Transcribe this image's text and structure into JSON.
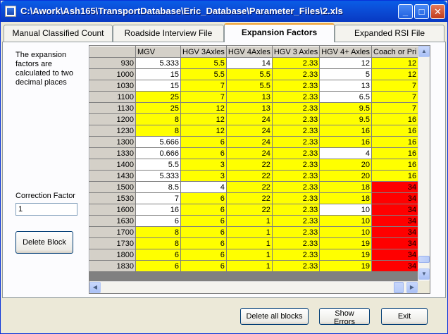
{
  "window": {
    "title": "C:\\Awork\\Ash165\\TransportDatabase\\Eric_Database\\Parameter_Files\\2.xls"
  },
  "tabs": [
    {
      "label": "Manual Classified Count",
      "active": false
    },
    {
      "label": "Roadside Interview File",
      "active": false
    },
    {
      "label": "Expansion Factors",
      "active": true
    },
    {
      "label": "Expanded RSI File",
      "active": false
    }
  ],
  "info_text": "The expansion factors are calculated to two decimal places",
  "correction_factor": {
    "label": "Correction Factor",
    "value": "1"
  },
  "buttons": {
    "delete_block": "Delete Block",
    "delete_all_blocks": "Delete all blocks",
    "show_errors": "Show Errors",
    "exit": "Exit"
  },
  "colors": {
    "yellow": "#ffff00",
    "red": "#ff0000",
    "white": "#ffffff"
  },
  "grid": {
    "columns": [
      "MGV",
      "HGV 3Axles",
      "HGV 4Axles",
      "HGV 3 Axles",
      "HGV 4+ Axles",
      "Coach or Pri"
    ],
    "rows": [
      {
        "time": "930",
        "cells": [
          [
            "5.333",
            "w"
          ],
          [
            "5.5",
            "y"
          ],
          [
            "14",
            "w"
          ],
          [
            "2.33",
            "y"
          ],
          [
            "12",
            "w"
          ],
          [
            "12",
            "y"
          ]
        ]
      },
      {
        "time": "1000",
        "cells": [
          [
            "15",
            "w"
          ],
          [
            "5.5",
            "y"
          ],
          [
            "5.5",
            "y"
          ],
          [
            "2.33",
            "y"
          ],
          [
            "5",
            "w"
          ],
          [
            "12",
            "y"
          ]
        ]
      },
      {
        "time": "1030",
        "cells": [
          [
            "15",
            "w"
          ],
          [
            "7",
            "y"
          ],
          [
            "5.5",
            "y"
          ],
          [
            "2.33",
            "y"
          ],
          [
            "13",
            "w"
          ],
          [
            "7",
            "y"
          ]
        ]
      },
      {
        "time": "1100",
        "cells": [
          [
            "25",
            "y"
          ],
          [
            "7",
            "y"
          ],
          [
            "13",
            "y"
          ],
          [
            "2.33",
            "y"
          ],
          [
            "6.5",
            "w"
          ],
          [
            "7",
            "y"
          ]
        ]
      },
      {
        "time": "1130",
        "cells": [
          [
            "25",
            "y"
          ],
          [
            "12",
            "y"
          ],
          [
            "13",
            "y"
          ],
          [
            "2.33",
            "y"
          ],
          [
            "9.5",
            "y"
          ],
          [
            "7",
            "y"
          ]
        ]
      },
      {
        "time": "1200",
        "cells": [
          [
            "8",
            "y"
          ],
          [
            "12",
            "y"
          ],
          [
            "24",
            "y"
          ],
          [
            "2.33",
            "y"
          ],
          [
            "9.5",
            "y"
          ],
          [
            "16",
            "y"
          ]
        ]
      },
      {
        "time": "1230",
        "cells": [
          [
            "8",
            "y"
          ],
          [
            "12",
            "y"
          ],
          [
            "24",
            "y"
          ],
          [
            "2.33",
            "y"
          ],
          [
            "16",
            "y"
          ],
          [
            "16",
            "y"
          ]
        ]
      },
      {
        "time": "1300",
        "cells": [
          [
            "5.666",
            "w"
          ],
          [
            "6",
            "y"
          ],
          [
            "24",
            "y"
          ],
          [
            "2.33",
            "y"
          ],
          [
            "16",
            "y"
          ],
          [
            "16",
            "y"
          ]
        ]
      },
      {
        "time": "1330",
        "cells": [
          [
            "0.666",
            "w"
          ],
          [
            "6",
            "y"
          ],
          [
            "24",
            "y"
          ],
          [
            "2.33",
            "y"
          ],
          [
            "4",
            "w"
          ],
          [
            "16",
            "y"
          ]
        ]
      },
      {
        "time": "1400",
        "cells": [
          [
            "5.5",
            "w"
          ],
          [
            "3",
            "y"
          ],
          [
            "22",
            "y"
          ],
          [
            "2.33",
            "y"
          ],
          [
            "20",
            "y"
          ],
          [
            "16",
            "y"
          ]
        ]
      },
      {
        "time": "1430",
        "cells": [
          [
            "5.333",
            "w"
          ],
          [
            "3",
            "y"
          ],
          [
            "22",
            "y"
          ],
          [
            "2.33",
            "y"
          ],
          [
            "20",
            "y"
          ],
          [
            "16",
            "y"
          ]
        ]
      },
      {
        "time": "1500",
        "cells": [
          [
            "8.5",
            "w"
          ],
          [
            "4",
            "w"
          ],
          [
            "22",
            "y"
          ],
          [
            "2.33",
            "y"
          ],
          [
            "18",
            "y"
          ],
          [
            "34",
            "r"
          ]
        ]
      },
      {
        "time": "1530",
        "cells": [
          [
            "7",
            "w"
          ],
          [
            "6",
            "y"
          ],
          [
            "22",
            "y"
          ],
          [
            "2.33",
            "y"
          ],
          [
            "18",
            "y"
          ],
          [
            "34",
            "r"
          ]
        ]
      },
      {
        "time": "1600",
        "cells": [
          [
            "16",
            "w"
          ],
          [
            "6",
            "y"
          ],
          [
            "22",
            "y"
          ],
          [
            "2.33",
            "y"
          ],
          [
            "10",
            "w"
          ],
          [
            "34",
            "r"
          ]
        ]
      },
      {
        "time": "1630",
        "cells": [
          [
            "6",
            "w"
          ],
          [
            "6",
            "y"
          ],
          [
            "1",
            "y"
          ],
          [
            "2.33",
            "y"
          ],
          [
            "10",
            "y"
          ],
          [
            "34",
            "r"
          ]
        ]
      },
      {
        "time": "1700",
        "cells": [
          [
            "8",
            "y"
          ],
          [
            "6",
            "y"
          ],
          [
            "1",
            "y"
          ],
          [
            "2.33",
            "y"
          ],
          [
            "10",
            "y"
          ],
          [
            "34",
            "r"
          ]
        ]
      },
      {
        "time": "1730",
        "cells": [
          [
            "8",
            "y"
          ],
          [
            "6",
            "y"
          ],
          [
            "1",
            "y"
          ],
          [
            "2.33",
            "y"
          ],
          [
            "19",
            "y"
          ],
          [
            "34",
            "r"
          ]
        ]
      },
      {
        "time": "1800",
        "cells": [
          [
            "6",
            "y"
          ],
          [
            "6",
            "y"
          ],
          [
            "1",
            "y"
          ],
          [
            "2.33",
            "y"
          ],
          [
            "19",
            "y"
          ],
          [
            "34",
            "r"
          ]
        ]
      },
      {
        "time": "1830",
        "cells": [
          [
            "6",
            "y"
          ],
          [
            "6",
            "y"
          ],
          [
            "1",
            "y"
          ],
          [
            "2.33",
            "y"
          ],
          [
            "19",
            "y"
          ],
          [
            "34",
            "r"
          ]
        ]
      }
    ]
  }
}
